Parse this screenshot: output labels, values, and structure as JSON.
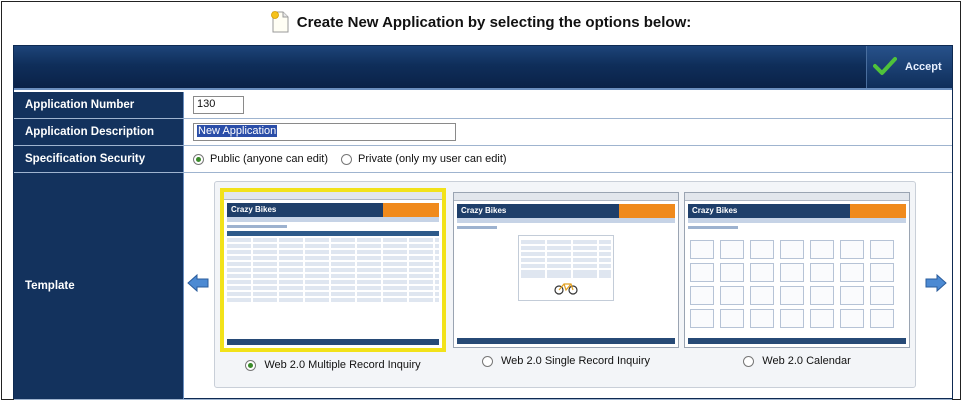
{
  "header": {
    "title": "Create New Application by selecting the options below:",
    "icon": "new-document-icon"
  },
  "toolbar": {
    "accept_label": "Accept",
    "accept_icon": "checkmark-icon"
  },
  "form": {
    "app_number": {
      "label": "Application Number",
      "value": "130"
    },
    "app_description": {
      "label": "Application Description",
      "value": "New Application"
    },
    "spec_security": {
      "label": "Specification Security",
      "options": [
        {
          "label": "Public (anyone can edit)",
          "selected": true
        },
        {
          "label": "Private (only my user can edit)",
          "selected": false
        }
      ]
    },
    "template": {
      "label": "Template",
      "prev_icon": "arrow-left-icon",
      "next_icon": "arrow-right-icon",
      "cards": [
        {
          "label": "Web 2.0 Multiple Record Inquiry",
          "selected": true,
          "brand": "Crazy Bikes"
        },
        {
          "label": "Web 2.0 Single Record Inquiry",
          "selected": false,
          "brand": "Crazy Bikes"
        },
        {
          "label": "Web 2.0 Calendar",
          "selected": false,
          "brand": "Crazy Bikes"
        }
      ]
    }
  },
  "colors": {
    "navy": "#13325d",
    "accent_orange": "#f08a1c",
    "selection_yellow": "#f2e21a",
    "check_green": "#3a8a2a"
  }
}
